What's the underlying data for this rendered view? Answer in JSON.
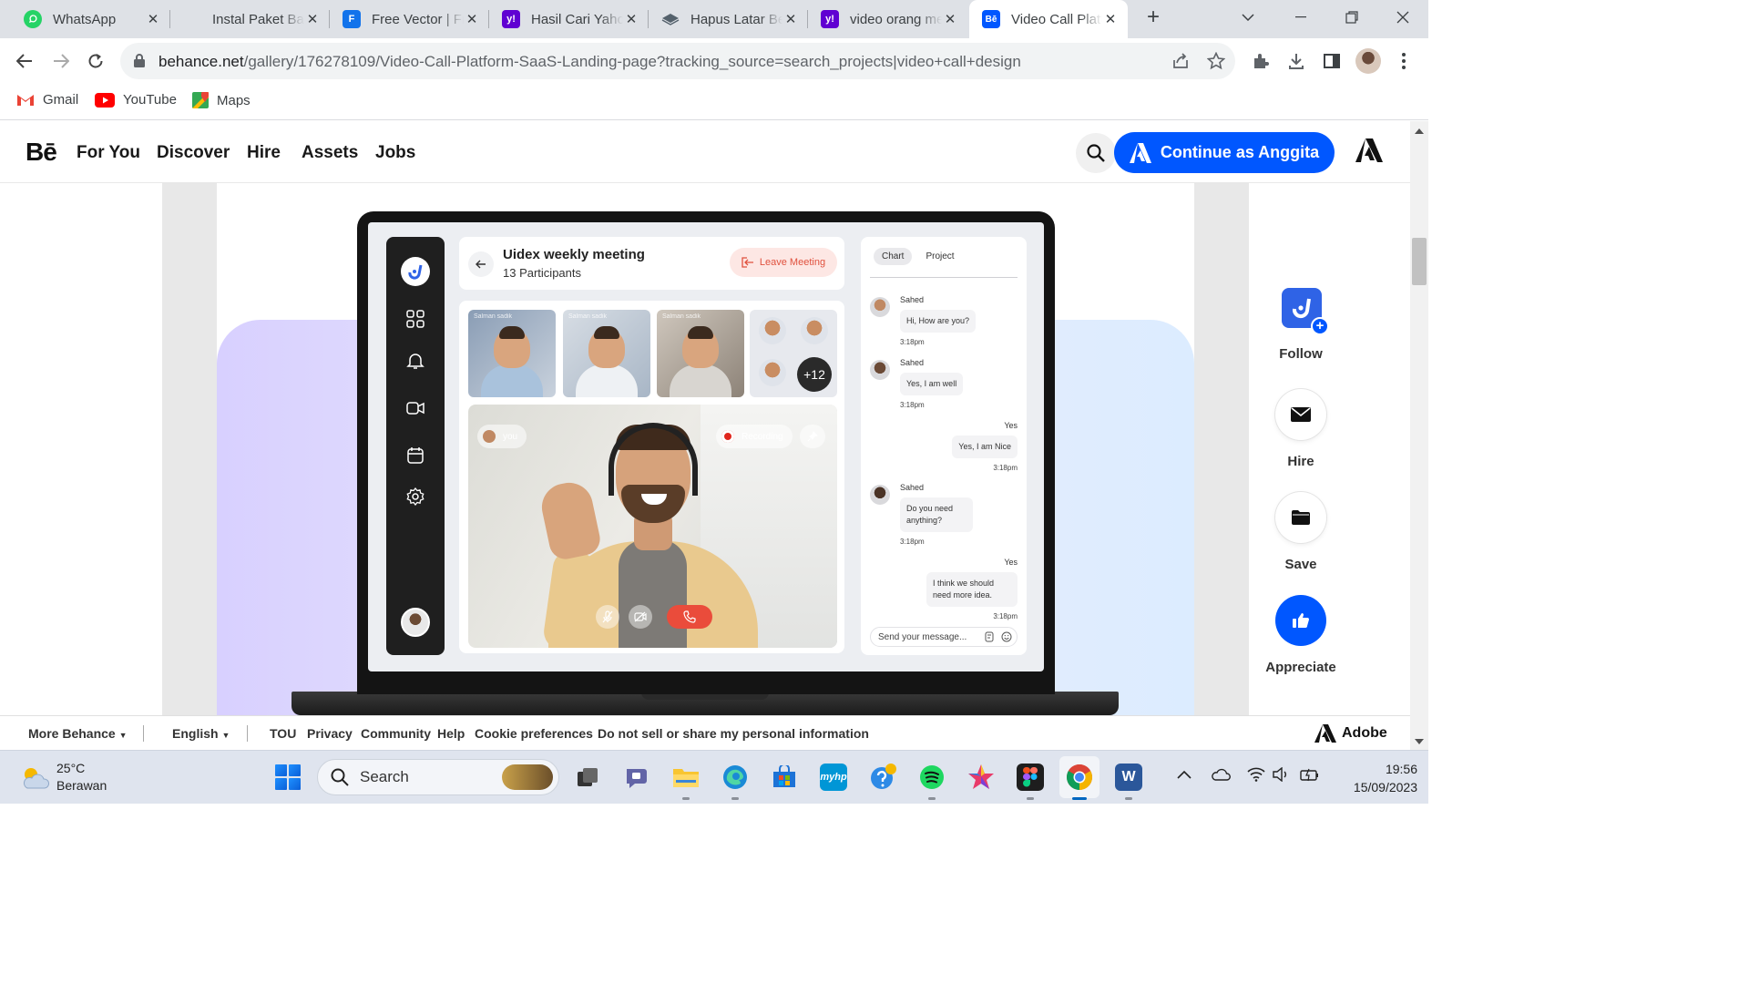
{
  "browser": {
    "tabs": [
      {
        "title": "WhatsApp",
        "icon": "whatsapp-icon",
        "color": "#25d366"
      },
      {
        "title": "Instal Paket Bahasa",
        "icon": "microsoft-icon",
        "color": "#f25022"
      },
      {
        "title": "Free Vector | Freepik",
        "icon": "freepik-icon",
        "color": "#1273eb"
      },
      {
        "title": "Hasil Cari Yahoo",
        "icon": "yahoo-icon",
        "color": "#6001d2"
      },
      {
        "title": "Hapus Latar Belakang",
        "icon": "removebg-icon",
        "color": "#54616c"
      },
      {
        "title": "video orang meeting",
        "icon": "yahoo-icon",
        "color": "#6001d2"
      },
      {
        "title": "Video Call Platform",
        "icon": "behance-icon",
        "color": "#0057ff",
        "active": true
      }
    ],
    "favicon_letters": {
      "yahoo": "y!",
      "behance": "Bē",
      "freepik": "F"
    },
    "url_host": "behance.net",
    "url_path": "/gallery/176278109/Video-Call-Platform-SaaS-Landing-page?tracking_source=search_projects|video+call+design",
    "bookmarks": [
      {
        "label": "Gmail",
        "icon": "gmail-icon"
      },
      {
        "label": "YouTube",
        "icon": "youtube-icon"
      },
      {
        "label": "Maps",
        "icon": "maps-icon"
      }
    ]
  },
  "behance": {
    "logo": "Bē",
    "nav": [
      "For You",
      "Discover",
      "Hire",
      "Assets",
      "Jobs"
    ],
    "cta": "Continue as Anggita",
    "accent": "#0057ff",
    "actions": [
      {
        "label": "Follow",
        "icon": "plus-badge-icon"
      },
      {
        "label": "Hire",
        "icon": "mail-icon"
      },
      {
        "label": "Save",
        "icon": "folder-icon"
      },
      {
        "label": "Appreciate",
        "icon": "thumbs-up-icon"
      }
    ],
    "footer": {
      "more": "More Behance",
      "language": "English",
      "links": [
        "TOU",
        "Privacy",
        "Community",
        "Help",
        "Cookie preferences",
        "Do not sell or share my personal information"
      ],
      "brand": "Adobe"
    }
  },
  "mockup": {
    "meeting_title": "Uidex weekly meeting",
    "participants": "13 Participants",
    "leave": "Leave Meeting",
    "tile_name": "Salman sadik",
    "more_count": "+12",
    "you_label": "you",
    "recording": "Recording",
    "chat_tabs": [
      "Chart",
      "Project"
    ],
    "messages": [
      {
        "from": "Sahed",
        "text": "Hi, How are you?",
        "time": "3:18pm"
      },
      {
        "from": "Sahed",
        "text": "Yes, I am well",
        "time": "3:18pm"
      },
      {
        "from": "Yes",
        "text": "Yes, I am Nice",
        "time": "3:18pm",
        "mine": true
      },
      {
        "from": "Sahed",
        "text": "Do you need anything?",
        "time": "3:18pm"
      },
      {
        "from": "Yes",
        "text": "I think we should need more idea.",
        "time": "3:18pm",
        "mine": true
      }
    ],
    "input_placeholder": "Send your message..."
  },
  "taskbar": {
    "temperature": "25°C",
    "weather": "Berawan",
    "search": "Search",
    "time": "19:56",
    "date": "15/09/2023",
    "apps": [
      "file-explorer-icon",
      "teams-icon",
      "folder-icon",
      "edge-icon",
      "store-icon",
      "myhp-icon",
      "help-icon",
      "spotify-icon",
      "star-app-icon",
      "figma-icon",
      "chrome-icon",
      "word-icon"
    ],
    "myhp_label": "myhp",
    "word_letter": "W"
  }
}
